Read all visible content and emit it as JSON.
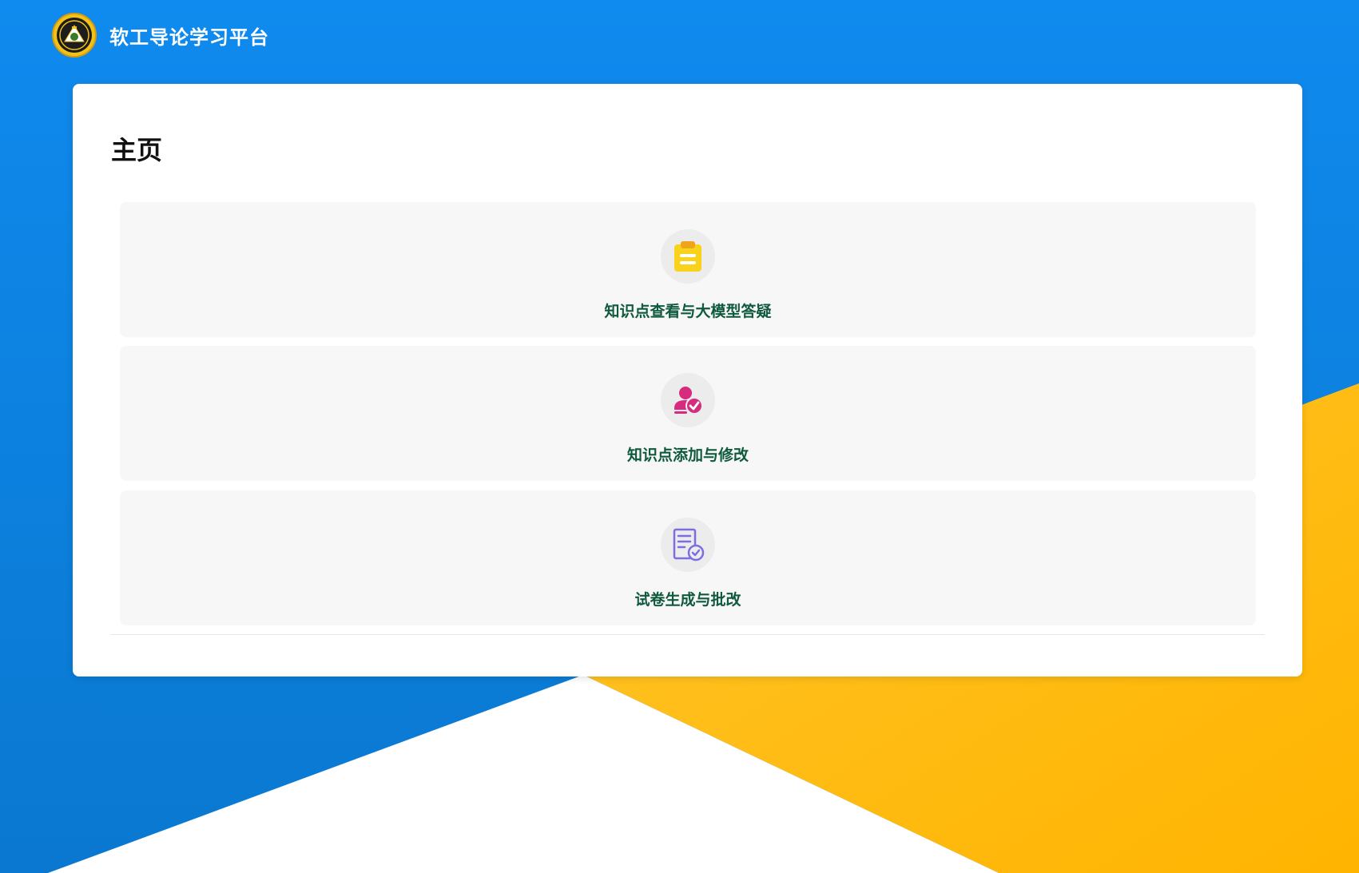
{
  "header": {
    "title": "软工导论学习平台",
    "logo_icon": "university-seal-icon"
  },
  "main": {
    "page_title": "主页",
    "features": [
      {
        "label": "知识点查看与大模型答疑",
        "icon": "clipboard-icon",
        "icon_color": "#f5c518"
      },
      {
        "label": "知识点添加与修改",
        "icon": "user-check-icon",
        "icon_color": "#d62b7e"
      },
      {
        "label": "试卷生成与批改",
        "icon": "document-check-icon",
        "icon_color": "#7b6fe0"
      }
    ]
  },
  "colors": {
    "background_blue": "#0a80de",
    "background_yellow": "#ffbf1a",
    "feature_label": "#0f5a3c"
  }
}
